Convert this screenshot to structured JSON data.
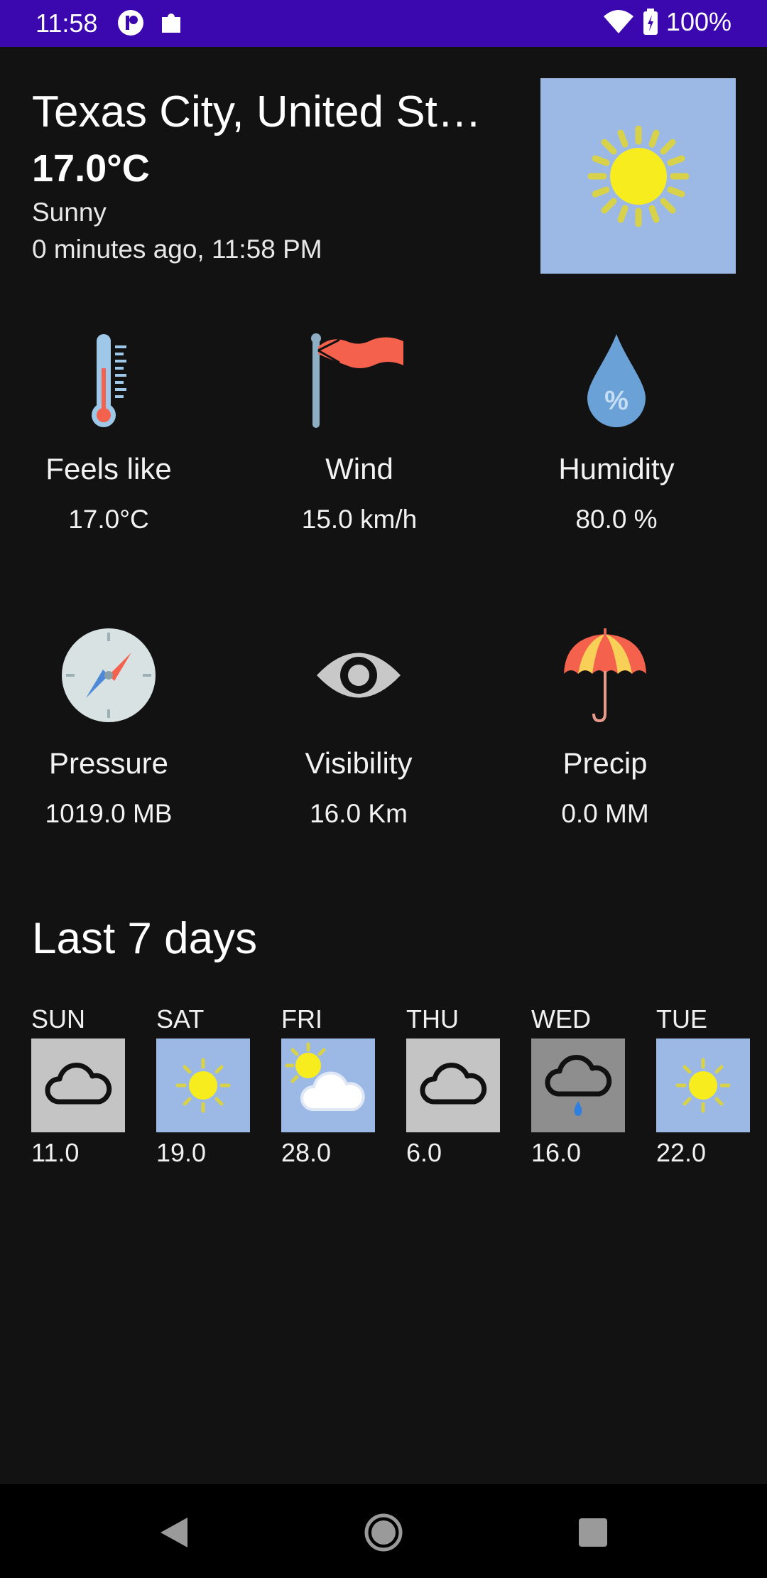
{
  "status_bar": {
    "time": "11:58",
    "battery": "100%",
    "left_icons": [
      "app-notification-icon",
      "puzzle-icon"
    ],
    "right_icons": [
      "wifi-icon",
      "battery-charging-icon"
    ],
    "background": "#3b08b0"
  },
  "current": {
    "location": "Texas City, United St…",
    "temperature": "17.0°C",
    "condition": "Sunny",
    "updated": "0 minutes ago, 11:58 PM",
    "icon": "sun-icon"
  },
  "metrics": [
    {
      "label": "Feels like",
      "value": "17.0°C",
      "icon": "thermometer-icon"
    },
    {
      "label": "Wind",
      "value": "15.0 km/h",
      "icon": "windsock-icon"
    },
    {
      "label": "Humidity",
      "value": "80.0 %",
      "icon": "humidity-drop-icon"
    },
    {
      "label": "Pressure",
      "value": "1019.0 MB",
      "icon": "compass-icon"
    },
    {
      "label": "Visibility",
      "value": "16.0 Km",
      "icon": "eye-icon"
    },
    {
      "label": "Precip",
      "value": "0.0 MM",
      "icon": "umbrella-icon"
    }
  ],
  "history": {
    "title": "Last 7 days",
    "days": [
      {
        "day": "SUN",
        "temp": "11.0",
        "icon": "cloud-icon"
      },
      {
        "day": "SAT",
        "temp": "19.0",
        "icon": "sun-icon"
      },
      {
        "day": "FRI",
        "temp": "28.0",
        "icon": "partly-cloudy-icon"
      },
      {
        "day": "THU",
        "temp": "6.0",
        "icon": "cloud-icon"
      },
      {
        "day": "WED",
        "temp": "16.0",
        "icon": "rain-cloud-icon"
      },
      {
        "day": "TUE",
        "temp": "22.0",
        "icon": "sun-icon"
      }
    ]
  },
  "nav": [
    "back-icon",
    "home-icon",
    "recents-icon"
  ],
  "colors": {
    "sky_tile": "#9cb9e6",
    "cloud_tile": "#c4c4c4",
    "rain_tile": "#8e8e8e",
    "accent_red": "#f4614c"
  }
}
